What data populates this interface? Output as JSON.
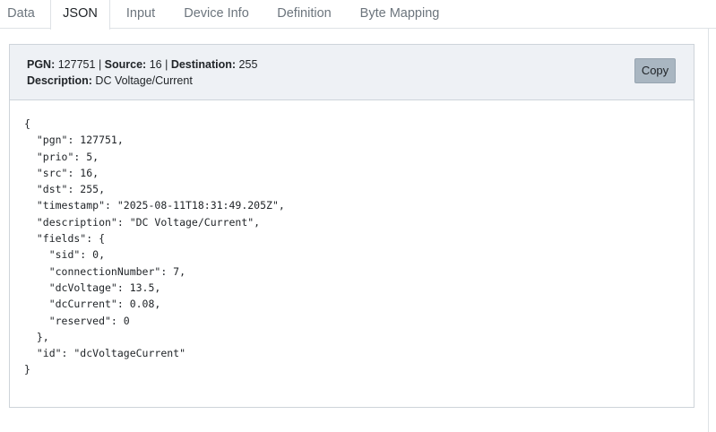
{
  "tabs": [
    {
      "label": "Data",
      "active": false
    },
    {
      "label": "JSON",
      "active": true
    },
    {
      "label": "Input",
      "active": false
    },
    {
      "label": "Device Info",
      "active": false
    },
    {
      "label": "Definition",
      "active": false
    },
    {
      "label": "Byte Mapping",
      "active": false
    }
  ],
  "header": {
    "pgn_label": "PGN:",
    "pgn_value": "127751",
    "source_label": "Source:",
    "source_value": "16",
    "destination_label": "Destination:",
    "destination_value": "255",
    "separator": "|",
    "description_label": "Description:",
    "description_value": "DC Voltage/Current",
    "copy_label": "Copy"
  },
  "json_text": "{\n  \"pgn\": 127751,\n  \"prio\": 5,\n  \"src\": 16,\n  \"dst\": 255,\n  \"timestamp\": \"2025-08-11T18:31:49.205Z\",\n  \"description\": \"DC Voltage/Current\",\n  \"fields\": {\n    \"sid\": 0,\n    \"connectionNumber\": 7,\n    \"dcVoltage\": 13.5,\n    \"dcCurrent\": 0.08,\n    \"reserved\": 0\n  },\n  \"id\": \"dcVoltageCurrent\"\n}"
}
